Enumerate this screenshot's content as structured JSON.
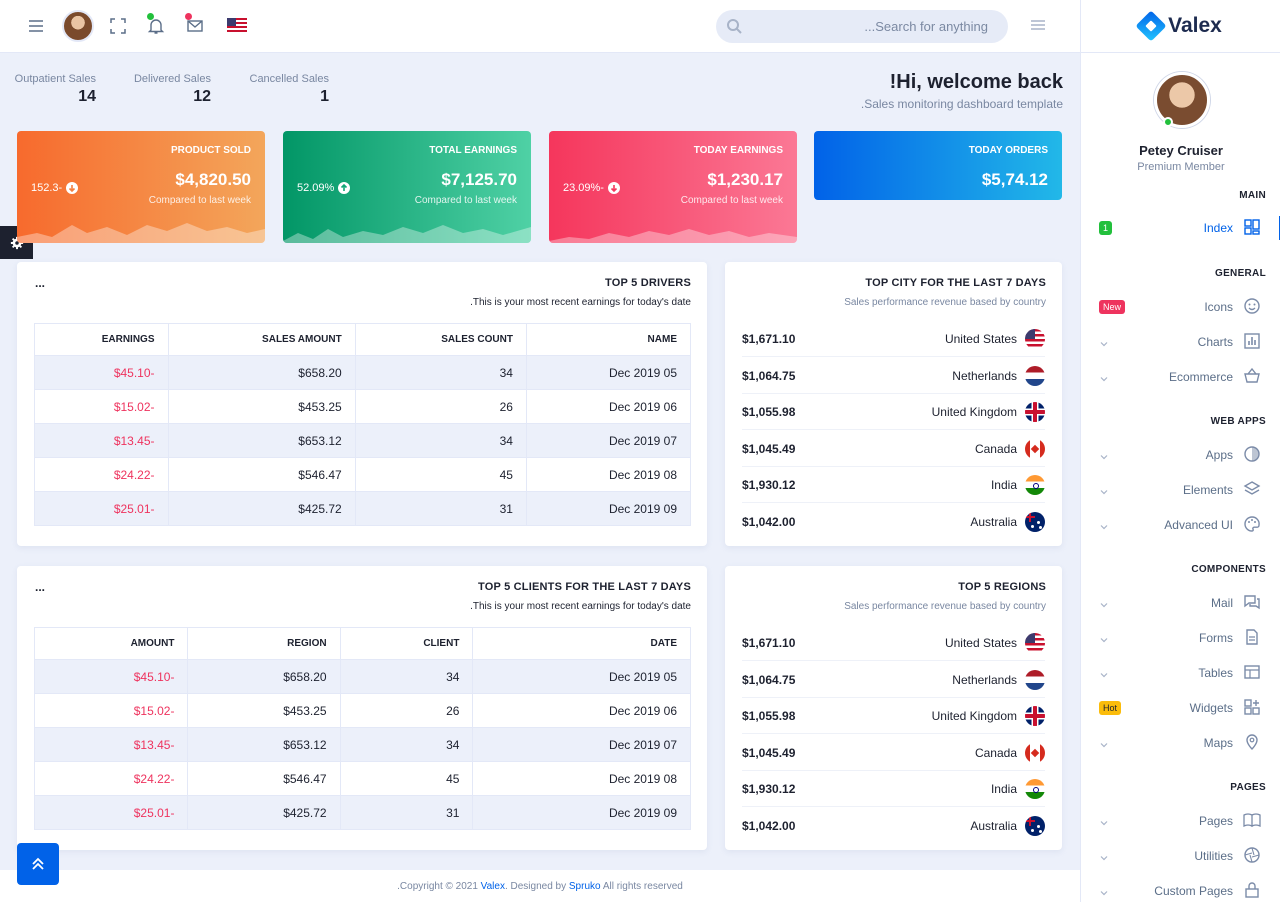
{
  "header": {
    "search_placeholder": "...Search for anything",
    "icons": [
      "menu-icon",
      "avatar",
      "fullscreen-icon",
      "bell-icon",
      "mail-icon",
      "us-flag",
      "search-icon",
      "right-menu-icon"
    ],
    "notification_dot_color": "#22c03c",
    "mail_dot_color": "#ee335e"
  },
  "stats": [
    {
      "label": "Outpatient Sales",
      "value": "14"
    },
    {
      "label": "Delivered Sales",
      "value": "12"
    },
    {
      "label": "Cancelled Sales",
      "value": "1"
    }
  ],
  "welcome": {
    "title": "!Hi, welcome back",
    "subtitle": ".Sales monitoring dashboard template"
  },
  "kpis": [
    {
      "title": "PRODUCT SOLD",
      "value": "$4,820.50",
      "compare": "Compared to last week",
      "percent": "152.3-",
      "direction": "down",
      "gradient": [
        "#f76a2d",
        "#f3a65b"
      ]
    },
    {
      "title": "TOTAL EARNINGS",
      "value": "$7,125.70",
      "compare": "Compared to last week",
      "percent": "52.09%",
      "direction": "up",
      "gradient": [
        "#029666",
        "#4fd1a5"
      ]
    },
    {
      "title": "TODAY EARNINGS",
      "value": "$1,230.17",
      "compare": "Compared to last week",
      "percent": "23.09%-",
      "direction": "down",
      "gradient": [
        "#f5365c",
        "#fb7895"
      ]
    },
    {
      "title": "TODAY ORDERS",
      "value": "$5,74.12",
      "gradient": [
        "#0162e8",
        "#22b8e8"
      ]
    }
  ],
  "drivers": {
    "more": "...",
    "title": "TOP 5 DRIVERS",
    "subtitle": ".This is your most recent earnings for today's date",
    "columns": [
      "EARNINGS",
      "SALES AMOUNT",
      "SALES COUNT",
      "NAME"
    ],
    "rows": [
      [
        "$45.10-",
        "$658.20",
        "34",
        "Dec 2019 05"
      ],
      [
        "$15.02-",
        "$453.25",
        "26",
        "Dec 2019 06"
      ],
      [
        "$13.45-",
        "$653.12",
        "34",
        "Dec 2019 07"
      ],
      [
        "$24.22-",
        "$546.47",
        "45",
        "Dec 2019 08"
      ],
      [
        "$25.01-",
        "$425.72",
        "31",
        "Dec 2019 09"
      ]
    ]
  },
  "clients": {
    "more": "...",
    "title": "TOP 5 CLIENTS FOR THE LAST 7 DAYS",
    "subtitle": ".This is your most recent earnings for today's date",
    "columns": [
      "AMOUNT",
      "REGION",
      "CLIENT",
      "DATE"
    ],
    "rows": [
      [
        "$45.10-",
        "$658.20",
        "34",
        "Dec 2019 05"
      ],
      [
        "$15.02-",
        "$453.25",
        "26",
        "Dec 2019 06"
      ],
      [
        "$13.45-",
        "$653.12",
        "34",
        "Dec 2019 07"
      ],
      [
        "$24.22-",
        "$546.47",
        "45",
        "Dec 2019 08"
      ],
      [
        "$25.01-",
        "$425.72",
        "31",
        "Dec 2019 09"
      ]
    ]
  },
  "cities": {
    "title": "TOP CITY FOR THE LAST 7 DAYS",
    "subtitle": "Sales performance revenue based by country",
    "rows": [
      {
        "value": "$1,671.10",
        "country": "United States",
        "flag": "us"
      },
      {
        "value": "$1,064.75",
        "country": "Netherlands",
        "flag": "nl"
      },
      {
        "value": "$1,055.98",
        "country": "United Kingdom",
        "flag": "uk"
      },
      {
        "value": "$1,045.49",
        "country": "Canada",
        "flag": "ca"
      },
      {
        "value": "$1,930.12",
        "country": "India",
        "flag": "in"
      },
      {
        "value": "$1,042.00",
        "country": "Australia",
        "flag": "au"
      }
    ]
  },
  "regions": {
    "title": "TOP 5 REGIONS",
    "subtitle": "Sales performance revenue based by country",
    "rows": [
      {
        "value": "$1,671.10",
        "country": "United States",
        "flag": "us"
      },
      {
        "value": "$1,064.75",
        "country": "Netherlands",
        "flag": "nl"
      },
      {
        "value": "$1,055.98",
        "country": "United Kingdom",
        "flag": "uk"
      },
      {
        "value": "$1,045.49",
        "country": "Canada",
        "flag": "ca"
      },
      {
        "value": "$1,930.12",
        "country": "India",
        "flag": "in"
      },
      {
        "value": "$1,042.00",
        "country": "Australia",
        "flag": "au"
      }
    ]
  },
  "sidebar": {
    "brand": "Valex",
    "user_name": "Petey Cruiser",
    "user_role": "Premium Member",
    "sections": [
      {
        "title": "MAIN",
        "items": [
          {
            "label": "Index",
            "icon": "dashboard-icon",
            "badge": "1",
            "badge_color": "#22c03c",
            "active": true
          }
        ]
      },
      {
        "title": "GENERAL",
        "items": [
          {
            "label": "Icons",
            "icon": "smile-icon",
            "badge": "New",
            "badge_color": "#ee335e"
          },
          {
            "label": "Charts",
            "icon": "chart-icon"
          },
          {
            "label": "Ecommerce",
            "icon": "basket-icon"
          }
        ]
      },
      {
        "title": "WEB APPS",
        "items": [
          {
            "label": "Apps",
            "icon": "pie-icon"
          },
          {
            "label": "Elements",
            "icon": "layers-icon"
          },
          {
            "label": "Advanced UI",
            "icon": "palette-icon"
          }
        ]
      },
      {
        "title": "COMPONENTS",
        "items": [
          {
            "label": "Mail",
            "icon": "chat-icon"
          },
          {
            "label": "Forms",
            "icon": "document-icon"
          },
          {
            "label": "Tables",
            "icon": "table-icon"
          },
          {
            "label": "Widgets",
            "icon": "widgets-icon",
            "badge": "Hot",
            "badge_color": "#fbbc0b"
          },
          {
            "label": "Maps",
            "icon": "map-pin-icon"
          }
        ]
      },
      {
        "title": "PAGES",
        "items": [
          {
            "label": "Pages",
            "icon": "book-icon"
          },
          {
            "label": "Utilities",
            "icon": "aperture-icon"
          },
          {
            "label": "Custom Pages",
            "icon": "lock-icon"
          }
        ]
      }
    ]
  },
  "footer": {
    "prefix": ".Copyright © 2021",
    "brand": "Valex",
    "middle": ". Designed by",
    "designer": "Spruko",
    "suffix": "All rights reserved"
  }
}
